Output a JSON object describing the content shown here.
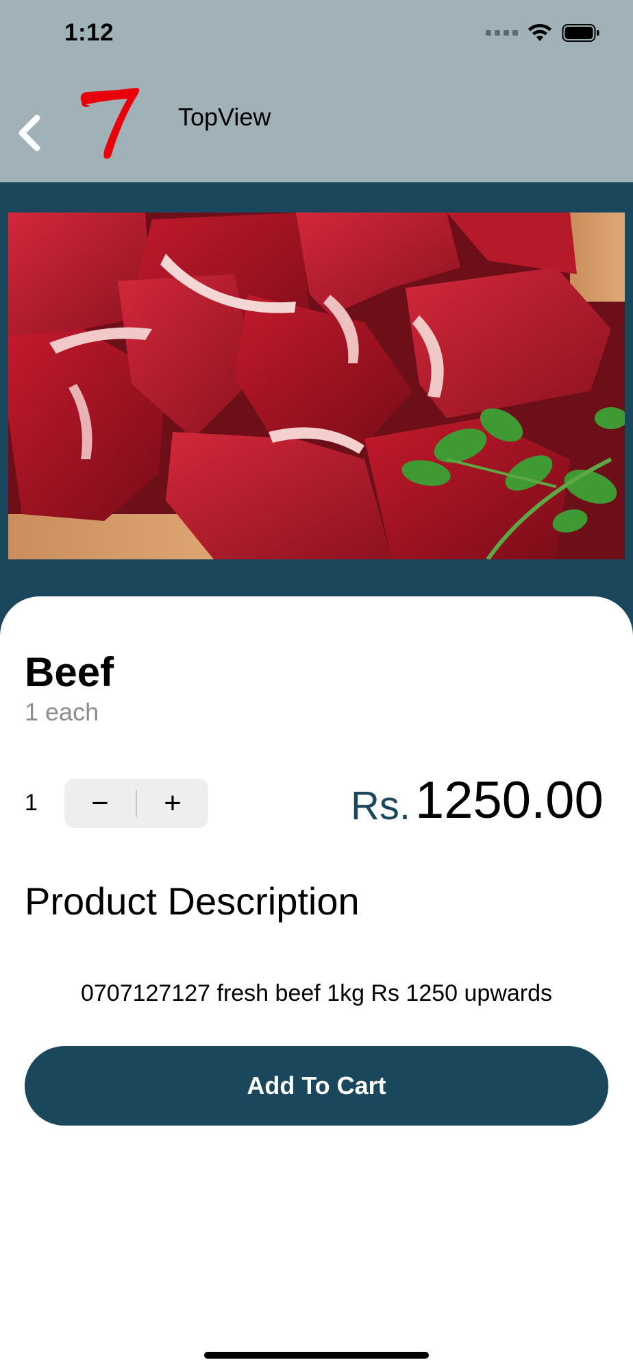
{
  "status_bar": {
    "time": "1:12"
  },
  "header": {
    "title": "TopView",
    "back_icon": "chevron-left-icon",
    "logo_icon": "red-seven-logo"
  },
  "product": {
    "name": "Beef",
    "unit": "1 each",
    "quantity": "1",
    "decrement_label": "−",
    "increment_label": "+",
    "currency": "Rs.",
    "price": "1250.00",
    "description_heading": "Product Description",
    "description": "0707127127 fresh beef 1kg Rs 1250 upwards"
  },
  "actions": {
    "add_to_cart": "Add To Cart"
  },
  "colors": {
    "header_bg": "#a0b1b8",
    "accent": "#1a475c",
    "logo": "#e8000b"
  }
}
